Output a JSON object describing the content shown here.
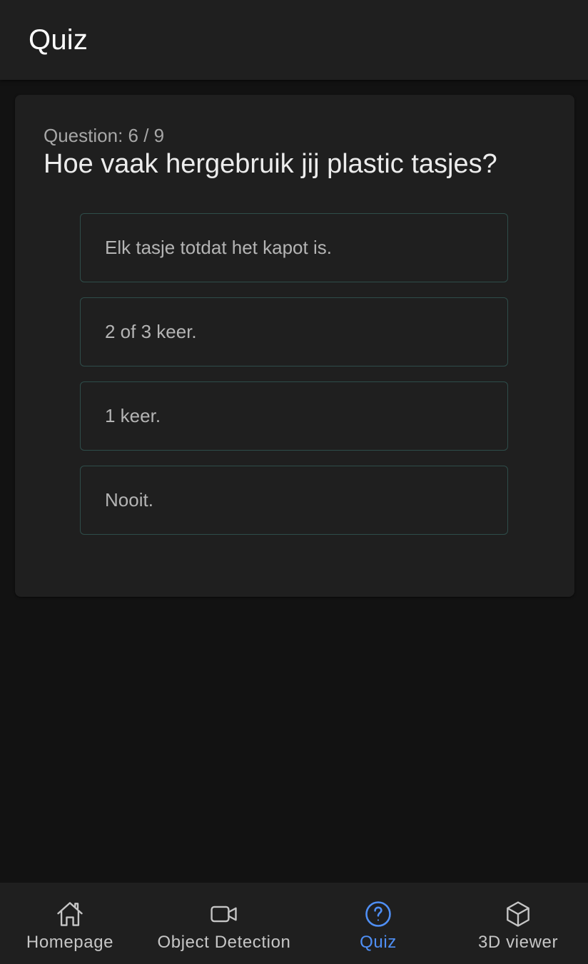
{
  "app_bar": {
    "title": "Quiz"
  },
  "quiz": {
    "counter": "Question: 6 / 9",
    "question": "Hoe vaak hergebruik jij plastic tasjes?",
    "answers": [
      "Elk tasje totdat het kapot is.",
      "2 of 3 keer.",
      "1 keer.",
      "Nooit."
    ]
  },
  "bottom_nav": {
    "items": [
      {
        "label": "Homepage",
        "icon": "home-icon",
        "active": false
      },
      {
        "label": "Object Detection",
        "icon": "video-camera-icon",
        "active": false
      },
      {
        "label": "Quiz",
        "icon": "help-circle-icon",
        "active": true
      },
      {
        "label": "3D viewer",
        "icon": "cube-icon",
        "active": false
      }
    ],
    "active_color": "#4f8ff5",
    "inactive_color": "#c6c6c6"
  },
  "colors": {
    "background": "#121212",
    "surface": "#1f1f1f",
    "answer_border": "#2e4d4a"
  }
}
